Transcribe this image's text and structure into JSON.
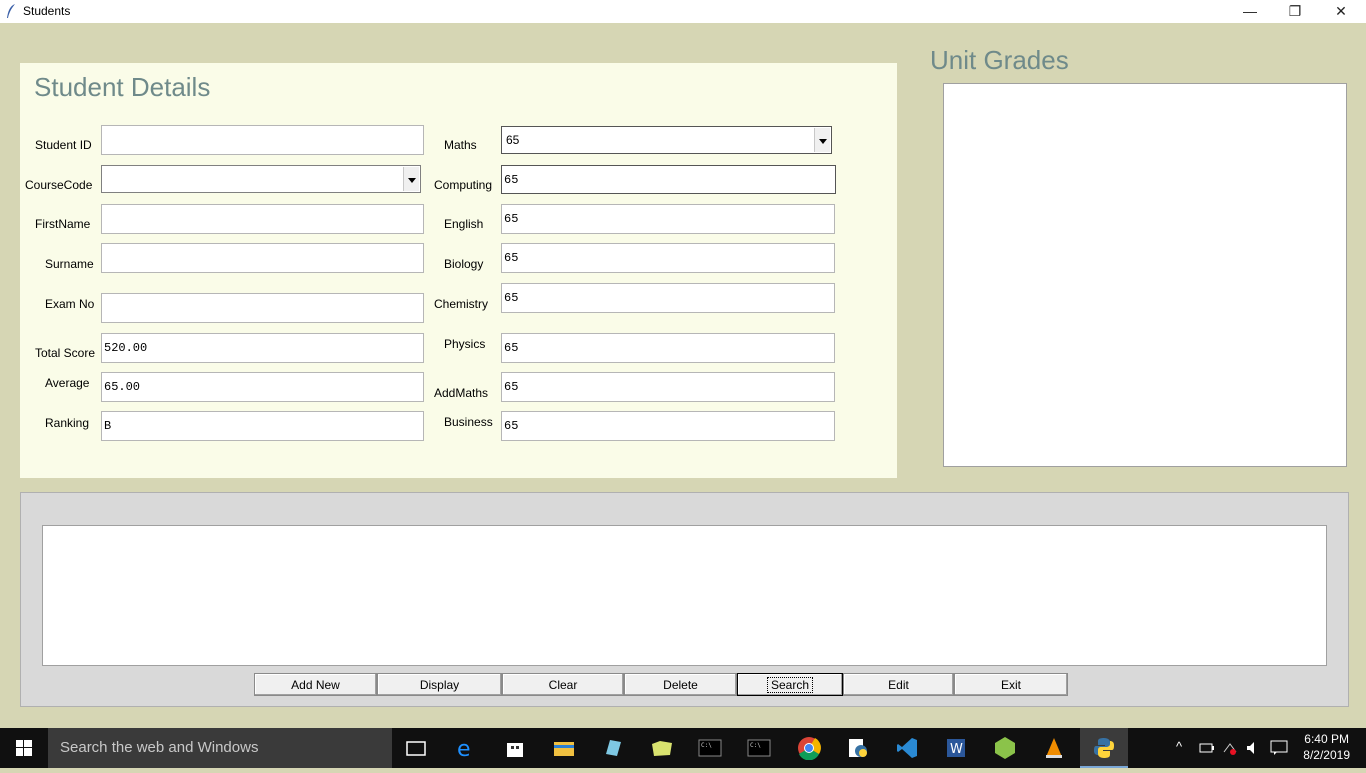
{
  "window": {
    "title": "Students",
    "min": "—",
    "max": "❐",
    "close": "✕"
  },
  "details": {
    "title": "Student Details",
    "left_fields": [
      {
        "label": "Student ID",
        "value": ""
      },
      {
        "label": "CourseCode",
        "value": ""
      },
      {
        "label": "FirstName",
        "value": ""
      },
      {
        "label": "Surname",
        "value": ""
      },
      {
        "label": "Exam No",
        "value": ""
      },
      {
        "label": "Total Score",
        "value": "520.00"
      },
      {
        "label": "Average",
        "value": "65.00"
      },
      {
        "label": "Ranking",
        "value": "B"
      }
    ],
    "right_fields": [
      {
        "label": "Maths",
        "value": "65"
      },
      {
        "label": "Computing",
        "value": "65"
      },
      {
        "label": "English",
        "value": "65"
      },
      {
        "label": "Biology",
        "value": "65"
      },
      {
        "label": "Chemistry",
        "value": "65"
      },
      {
        "label": "Physics",
        "value": "65"
      },
      {
        "label": "AddMaths",
        "value": "65"
      },
      {
        "label": "Business",
        "value": "65"
      }
    ]
  },
  "grades": {
    "title": "Unit Grades"
  },
  "buttons": [
    "Add New",
    "Display",
    "Clear",
    "Delete",
    "Search",
    "Edit",
    "Exit"
  ],
  "taskbar": {
    "search_placeholder": "Search the web and Windows",
    "time": "6:40 PM",
    "date": "8/2/2019",
    "tray_arrow": "^"
  }
}
